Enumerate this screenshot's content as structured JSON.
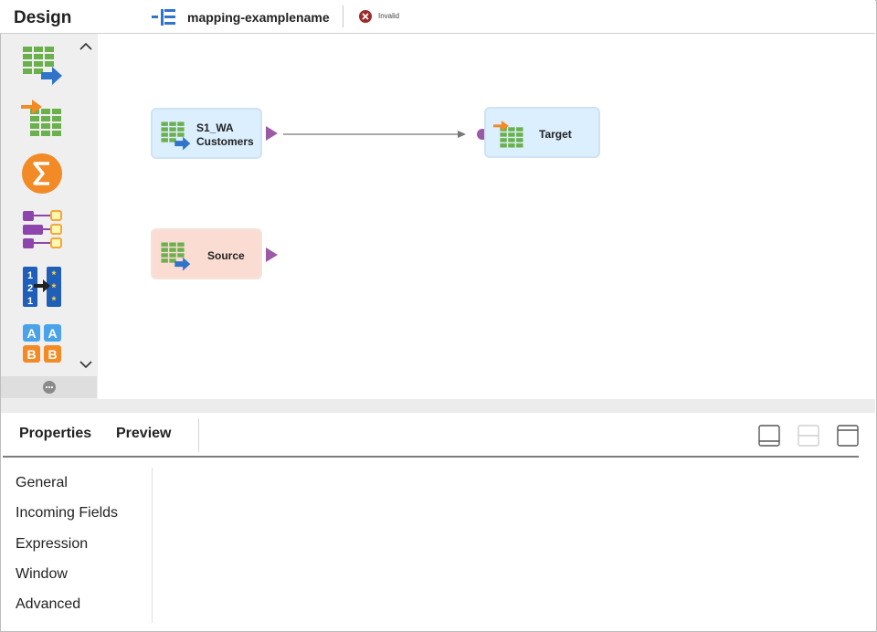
{
  "header": {
    "title": "Design",
    "mapping_name": "mapping-examplename",
    "status": "Invalid",
    "status_color": "#9e2a2a"
  },
  "palette": {
    "items": [
      {
        "name": "source-transform-icon"
      },
      {
        "name": "target-transform-icon"
      },
      {
        "name": "aggregator-icon"
      },
      {
        "name": "hierarchy-icon"
      },
      {
        "name": "sequence-generator-icon"
      },
      {
        "name": "data-masking-icon"
      }
    ],
    "scroll_up": "^",
    "scroll_down": "v"
  },
  "canvas": {
    "nodes": [
      {
        "id": "s1wa",
        "label_line1": "S1_WA",
        "label_line2": "Customers",
        "type": "source",
        "color": "#dcefff"
      },
      {
        "id": "target",
        "label": "Target",
        "type": "target",
        "color": "#dcefff"
      },
      {
        "id": "source",
        "label": "Source",
        "type": "source",
        "color": "#fbdcd3"
      }
    ],
    "links": [
      {
        "from": "s1wa",
        "to": "target"
      }
    ]
  },
  "properties": {
    "tabs": [
      "Properties",
      "Preview"
    ],
    "nav_items": [
      "General",
      "Incoming Fields",
      "Expression",
      "Window",
      "Advanced"
    ]
  },
  "colors": {
    "accent_blue": "#2f74c9",
    "accent_orange": "#f28a25",
    "port_purple": "#9b59a6",
    "grid_green": "#6ab04c"
  }
}
